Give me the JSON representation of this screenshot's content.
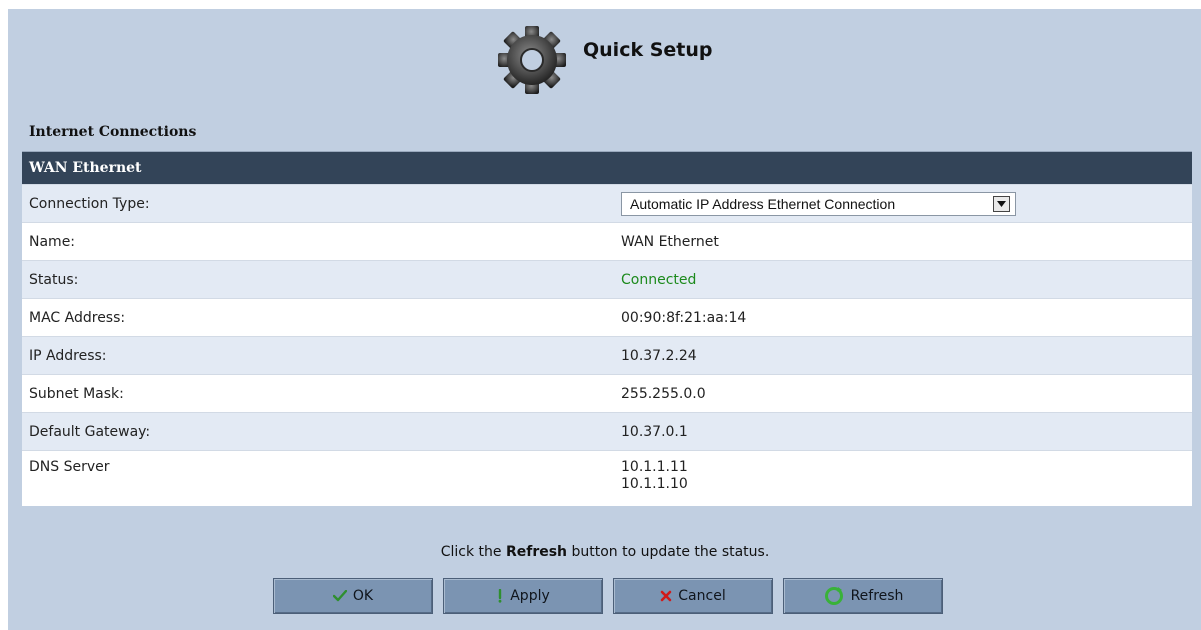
{
  "header": {
    "title": "Quick Setup",
    "icon": "gear-icon"
  },
  "section": {
    "title": "Internet Connections"
  },
  "table": {
    "heading": "WAN Ethernet",
    "rows": [
      {
        "label": "Connection Type:",
        "value": "Automatic IP Address Ethernet Connection"
      },
      {
        "label": "Name:",
        "value": "WAN Ethernet"
      },
      {
        "label": "Status:",
        "value": "Connected"
      },
      {
        "label": "MAC Address:",
        "value": "00:90:8f:21:aa:14"
      },
      {
        "label": "IP Address:",
        "value": "10.37.2.24"
      },
      {
        "label": "Subnet Mask:",
        "value": "255.255.0.0"
      },
      {
        "label": "Default Gateway:",
        "value": "10.37.0.1"
      },
      {
        "label": "DNS Server",
        "values": [
          "10.1.1.11",
          "10.1.1.10"
        ]
      }
    ]
  },
  "hint": {
    "prefix": "Click the ",
    "bold": "Refresh",
    "suffix": " button to update the status."
  },
  "buttons": {
    "ok": "OK",
    "apply": "Apply",
    "cancel": "Cancel",
    "refresh": "Refresh"
  },
  "colors": {
    "panel_bg": "#c1cfe1",
    "table_header_bg": "#334458",
    "status_connected": "#1c8a1c",
    "button_bg": "#7b94b2"
  }
}
